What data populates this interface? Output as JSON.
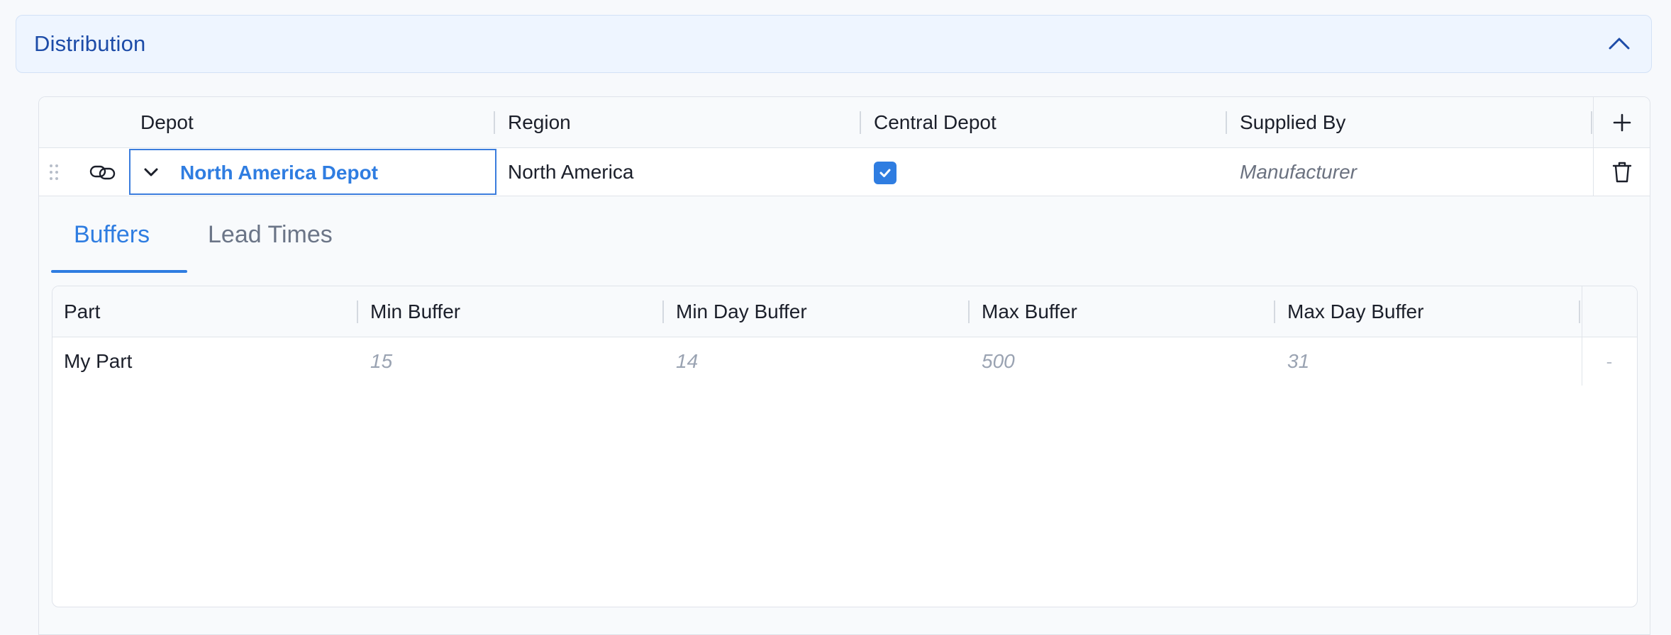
{
  "section": {
    "title": "Distribution"
  },
  "depots_table": {
    "columns": [
      "Depot",
      "Region",
      "Central Depot",
      "Supplied By"
    ],
    "rows": [
      {
        "depot": "North America Depot",
        "region": "North America",
        "central_depot": true,
        "supplied_by": "Manufacturer"
      }
    ]
  },
  "tabs": [
    {
      "label": "Buffers",
      "active": true
    },
    {
      "label": "Lead Times",
      "active": false
    }
  ],
  "buffers_table": {
    "columns": [
      "Part",
      "Min Buffer",
      "Min Day Buffer",
      "Max Buffer",
      "Max Day Buffer"
    ],
    "rows": [
      {
        "part": "My Part",
        "min_buffer": "15",
        "min_day_buffer": "14",
        "max_buffer": "500",
        "max_day_buffer": "31",
        "action": "-"
      }
    ]
  },
  "colors": {
    "accent": "#2f7de1",
    "section_title": "#1d4ca8",
    "section_bg": "#eef5ff"
  }
}
